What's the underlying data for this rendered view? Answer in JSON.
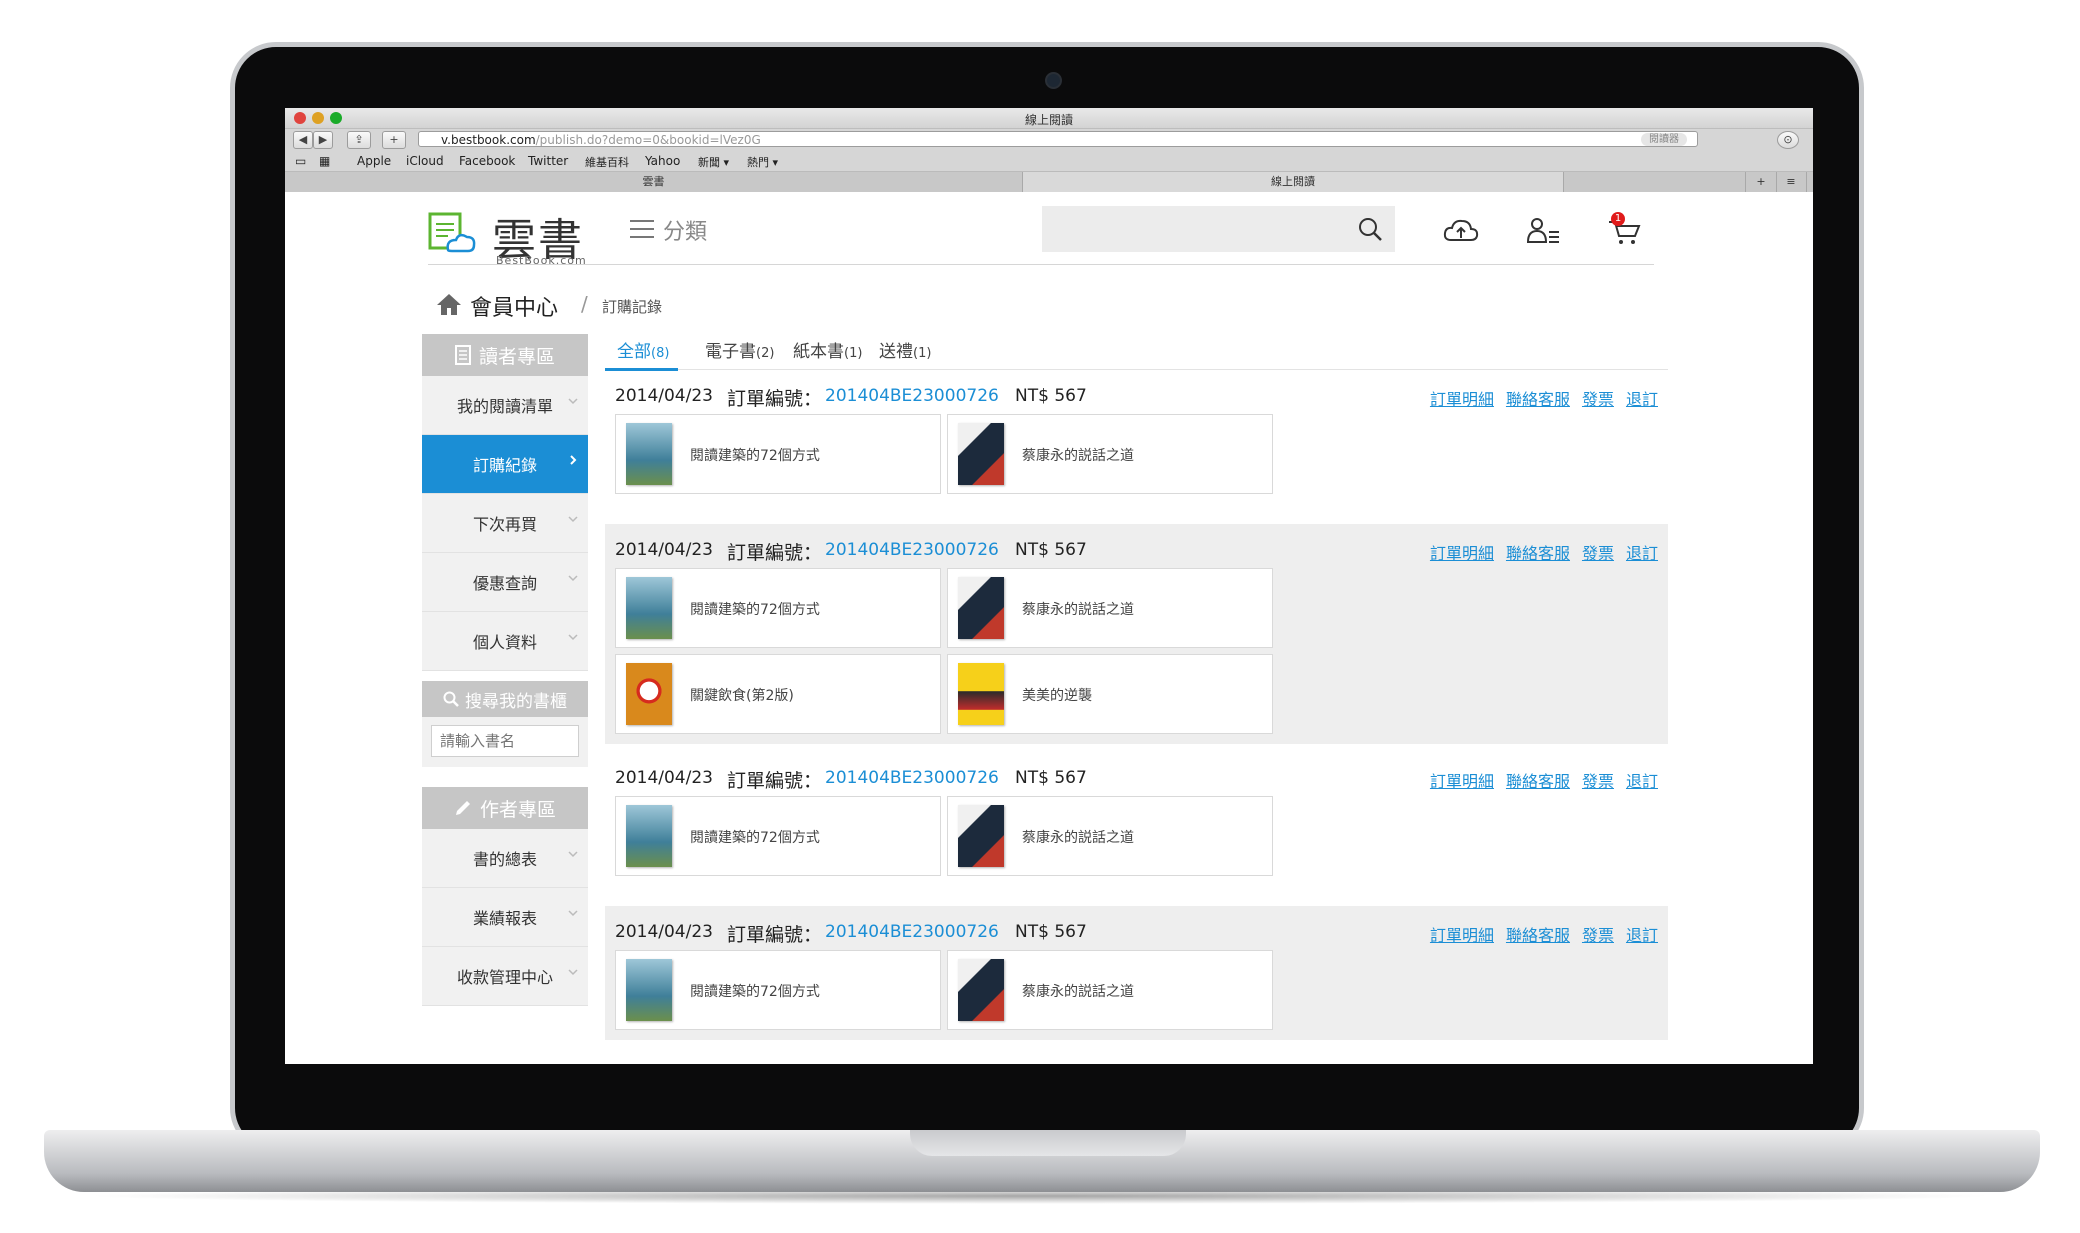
{
  "browser": {
    "window_title": "線上閱讀",
    "url_domain": "v.bestbook.com",
    "url_path": "/publish.do?demo=0&bookid=lVez0G",
    "reader_label": "閱讀器",
    "bookmarks": [
      "Apple",
      "iCloud",
      "Facebook",
      "Twitter",
      "維基百科",
      "Yahoo",
      "新聞 ▾",
      "熱門 ▾"
    ],
    "tabs": [
      "雲書",
      "線上閱讀"
    ]
  },
  "site": {
    "logo_text": "雲書",
    "logo_sub": "BestBook.com",
    "category_label": "分類",
    "cart_count": "1",
    "colors": {
      "accent": "#1b8ed5",
      "badge": "#e01b1b"
    }
  },
  "breadcrumb": {
    "main": "會員中心",
    "separator": "/",
    "sub": "訂購記錄"
  },
  "sidebar": {
    "reader_head": "讀者專區",
    "reader_items": [
      {
        "label": "我的閱讀清單"
      },
      {
        "label": "訂購紀錄"
      },
      {
        "label": "下次再買"
      },
      {
        "label": "優惠查詢"
      },
      {
        "label": "個人資料"
      }
    ],
    "search_head": "搜尋我的書櫃",
    "search_placeholder": "請輸入書名",
    "author_head": "作者專區",
    "author_items": [
      {
        "label": "書的總表"
      },
      {
        "label": "業績報表"
      },
      {
        "label": "收款管理中心"
      }
    ]
  },
  "content_tabs": [
    {
      "label": "全部",
      "count": "(8)"
    },
    {
      "label": "電子書",
      "count": "(2)"
    },
    {
      "label": "紙本書",
      "count": "(1)"
    },
    {
      "label": "送禮",
      "count": "(1)"
    }
  ],
  "order_labels": {
    "number_label": "訂單編號：",
    "links": [
      "訂單明細",
      "聯絡客服",
      "發票",
      "退訂"
    ]
  },
  "orders": [
    {
      "date": "2014/04/23",
      "number": "201404BE23000726",
      "price": "NT$ 567",
      "books": [
        "閱讀建築的72個方式",
        "蔡康永的説話之道"
      ]
    },
    {
      "date": "2014/04/23",
      "number": "201404BE23000726",
      "price": "NT$ 567",
      "books": [
        "閱讀建築的72個方式",
        "蔡康永的説話之道",
        "關鍵飲食(第2版)",
        "美美的逆襲"
      ]
    },
    {
      "date": "2014/04/23",
      "number": "201404BE23000726",
      "price": "NT$ 567",
      "books": [
        "閱讀建築的72個方式",
        "蔡康永的説話之道"
      ]
    },
    {
      "date": "2014/04/23",
      "number": "201404BE23000726",
      "price": "NT$ 567",
      "books": [
        "閱讀建築的72個方式",
        "蔡康永的説話之道"
      ]
    }
  ]
}
